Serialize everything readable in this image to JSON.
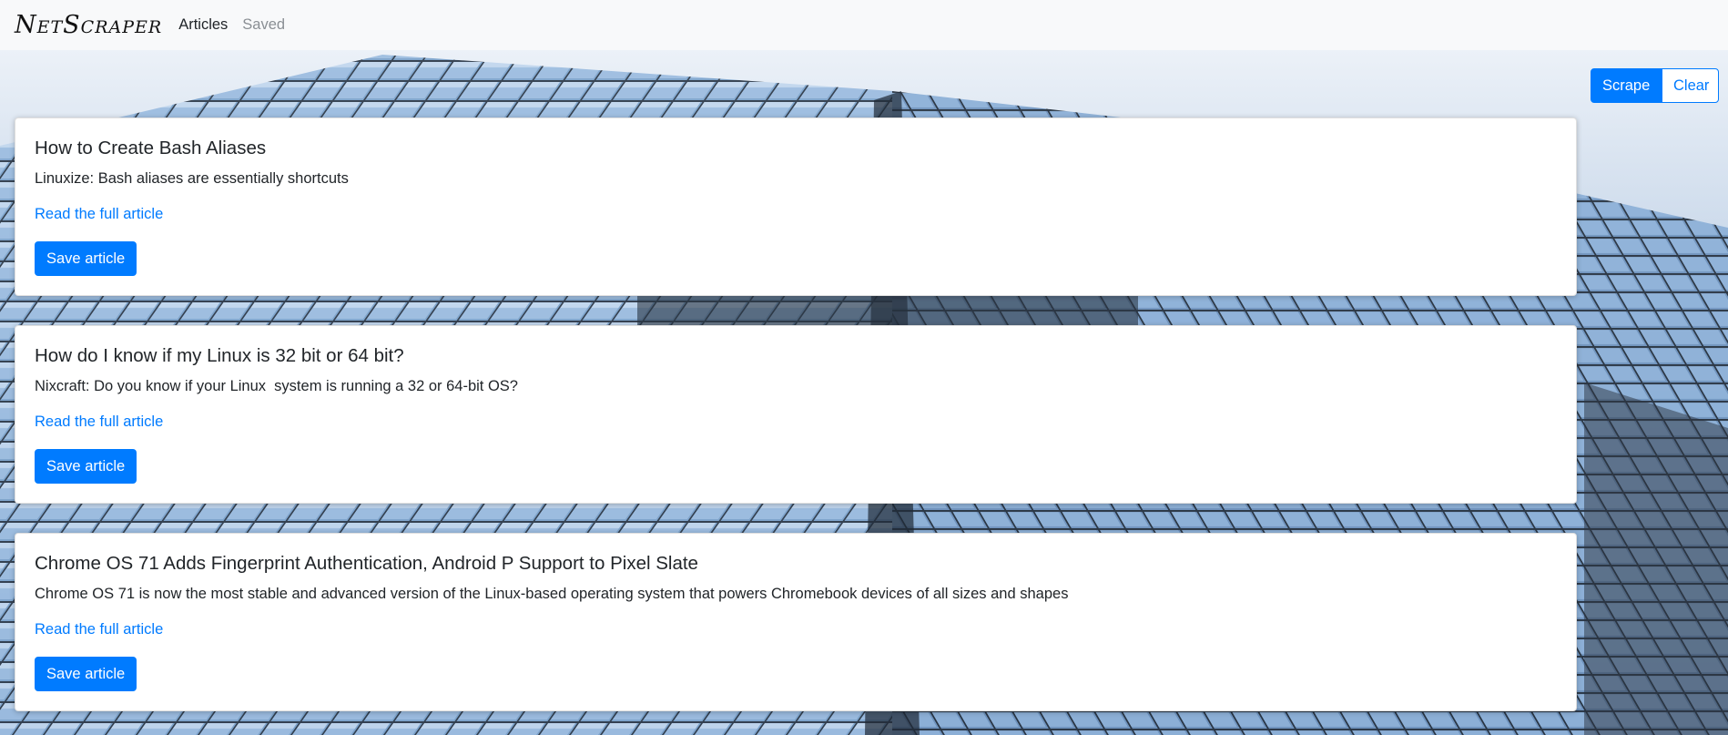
{
  "navbar": {
    "brand": "NetScraper",
    "links": [
      {
        "label": "Articles",
        "state": "active"
      },
      {
        "label": "Saved",
        "state": "muted"
      }
    ]
  },
  "actions": {
    "scrape_label": "Scrape",
    "clear_label": "Clear"
  },
  "articles": [
    {
      "title": "How to Create Bash Aliases",
      "summary": "Linuxize: Bash aliases are essentially shortcuts",
      "link_label": "Read the full article",
      "save_label": "Save article"
    },
    {
      "title": "How do I know if my Linux is 32 bit or 64 bit?",
      "summary": "Nixcraft: Do you know if your Linux  system is running a 32 or 64-bit OS?",
      "link_label": "Read the full article",
      "save_label": "Save article"
    },
    {
      "title": "Chrome OS 71 Adds Fingerprint Authentication, Android P Support to Pixel Slate",
      "summary": "Chrome OS 71 is now the most stable and advanced version of the Linux-based operating system that powers Chromebook devices of all sizes and shapes",
      "link_label": "Read the full article",
      "save_label": "Save article"
    }
  ],
  "colors": {
    "primary": "#007bff",
    "navbar_bg": "#f8f9fa"
  }
}
